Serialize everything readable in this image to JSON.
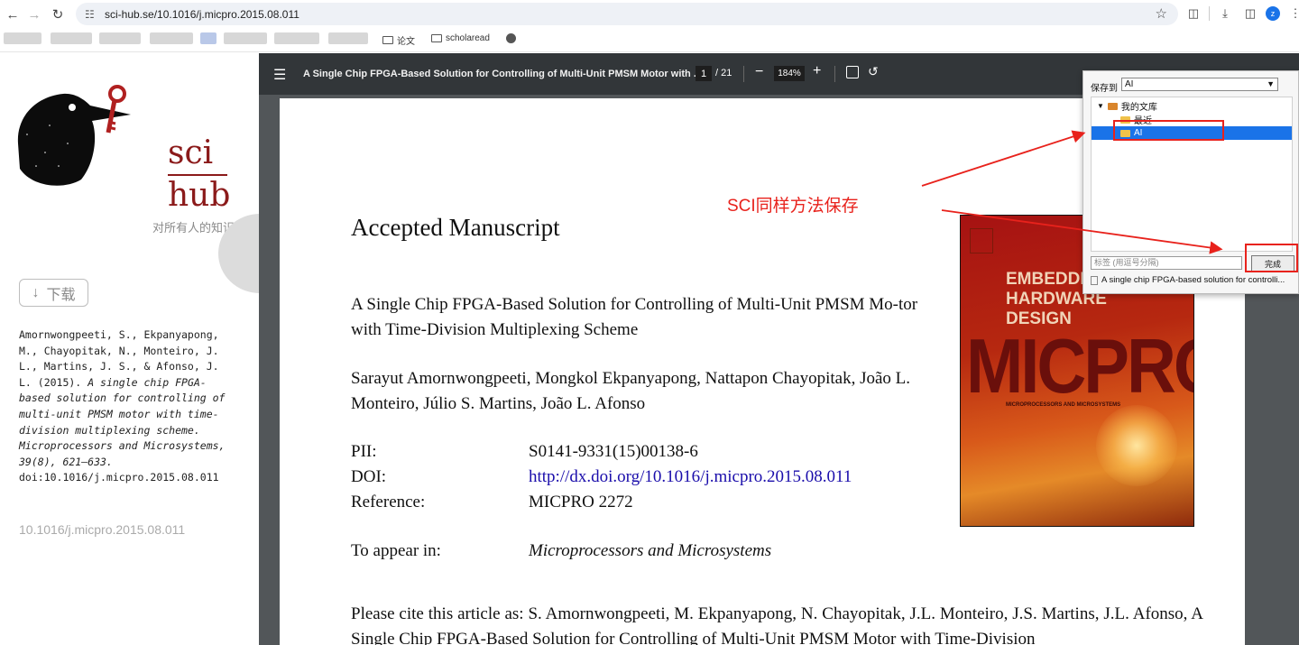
{
  "browser": {
    "url": "sci-hub.se/10.1016/j.micpro.2015.08.011",
    "bookmarks": [
      {
        "label": "论文"
      },
      {
        "label": "scholaread"
      }
    ],
    "profile_initial": "z"
  },
  "sidebar": {
    "logo_line1": "sci",
    "logo_line2": "hub",
    "tagline": "对所有人的知识",
    "download_label": "下载",
    "citation": {
      "authors": "Amornwongpeeti, S., Ekpanyapong, M., Chayopitak, N., Monteiro, J. L., Martins, J. S., & Afonso, J. L. (2015).",
      "title_journal": "A single chip FPGA-based solution for controlling of multi-unit PMSM motor with time-division multiplexing scheme. Microprocessors and Microsystems, 39(8), 621–633.",
      "doi": "doi:10.1016/j.micpro.2015.08.011"
    },
    "doi_link": "10.1016/j.micpro.2015.08.011"
  },
  "viewer": {
    "title": "A Single Chip FPGA-Based Solution for Controlling of Multi-Unit PMSM Motor with ...",
    "page_current": "1",
    "page_total": "/ 21",
    "zoom": "184%"
  },
  "pdf": {
    "heading": "Accepted Manuscript",
    "title": "A Single Chip FPGA-Based Solution for Controlling of Multi-Unit PMSM Mo-tor with Time-Division Multiplexing Scheme",
    "authors": "Sarayut Amornwongpeeti, Mongkol Ekpanyapong, Nattapon Chayopitak, João L. Monteiro, Júlio S. Martins, João L. Afonso",
    "meta": [
      {
        "key": "PII:",
        "value": "S0141-9331(15)00138-6"
      },
      {
        "key": "DOI:",
        "value": "http://dx.doi.org/10.1016/j.micpro.2015.08.011"
      },
      {
        "key": "Reference:",
        "value": "MICPRO 2272"
      }
    ],
    "appear_key": "To appear in:",
    "appear_value": "Microprocessors and Microsystems",
    "cite": "Please cite this article as: S. Amornwongpeeti, M. Ekpanyapong, N. Chayopitak, J.L. Monteiro, J.S. Martins, J.L. Afonso, A Single Chip FPGA-Based Solution for Controlling of Multi-Unit PMSM Motor with Time-Division",
    "cover": {
      "line1": "EMBEDDED",
      "line2": "HARDWARE",
      "line3": "DESIGN",
      "journal": "MICPRO",
      "subtitle": "MICROPROCESSORS AND MICROSYSTEMS"
    }
  },
  "save_dialog": {
    "save_to_label": "保存到",
    "selected_folder": "AI",
    "tree": [
      {
        "label": "我的文库"
      },
      {
        "label": "最近"
      },
      {
        "label": "AI"
      }
    ],
    "tags_placeholder": "标签 (用逗号分隔)",
    "done_label": "完成",
    "file_name": "A single chip FPGA-based solution for controlli..."
  },
  "annotation": {
    "text": "SCI同样方法保存",
    "color": "#e8221c"
  }
}
